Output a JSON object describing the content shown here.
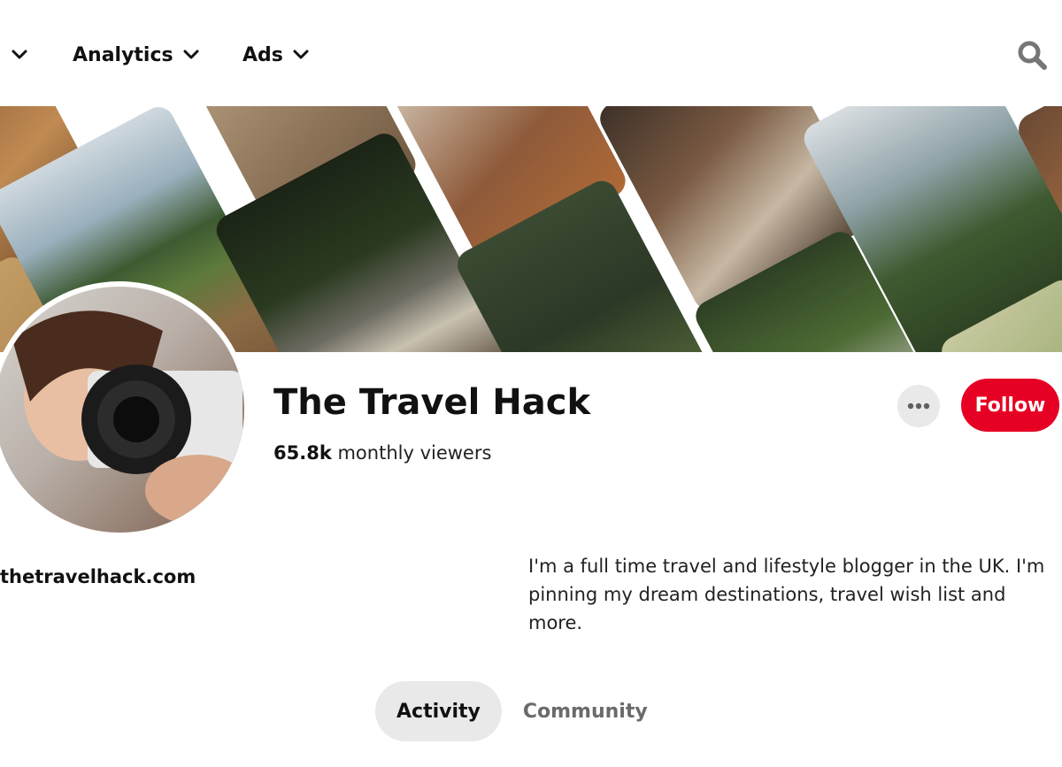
{
  "nav": {
    "items": [
      {
        "label": ""
      },
      {
        "label": "Analytics"
      },
      {
        "label": "Ads"
      }
    ]
  },
  "profile": {
    "name": "The Travel Hack",
    "viewers_count": "65.8k",
    "viewers_label": "monthly viewers",
    "website": "thetravelhack.com",
    "bio": "I'm a full time travel and lifestyle blogger in the UK. I'm pinning my dream destinations, travel wish list and more.",
    "follow_label": "Follow"
  },
  "tabs": [
    {
      "label": "Activity",
      "active": true
    },
    {
      "label": "Community",
      "active": false
    }
  ],
  "colors": {
    "accent": "#e60023",
    "tab_active_bg": "#e9e9e9"
  }
}
